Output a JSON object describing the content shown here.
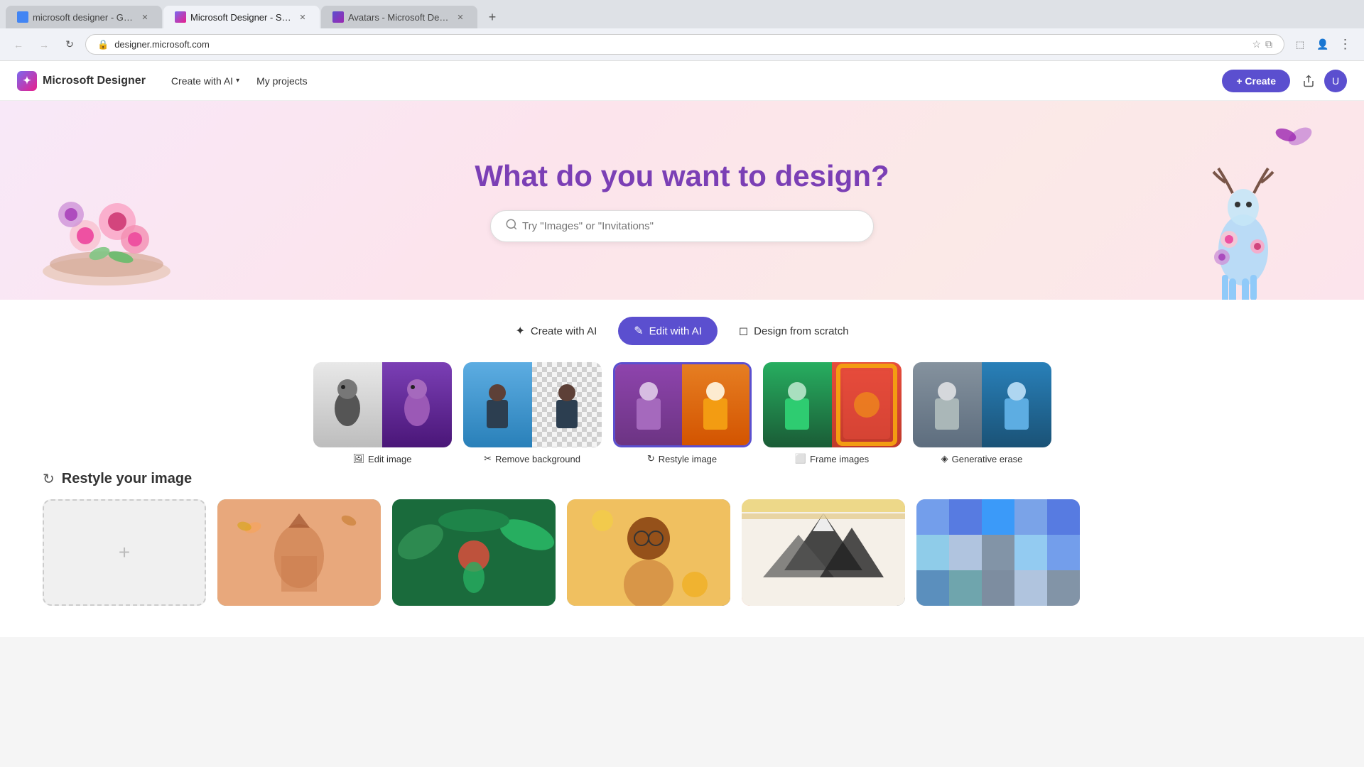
{
  "browser": {
    "tabs": [
      {
        "id": "tab1",
        "title": "microsoft designer - Google S...",
        "favicon_type": "google",
        "active": false,
        "url": ""
      },
      {
        "id": "tab2",
        "title": "Microsoft Designer - Stunning ...",
        "favicon_type": "msdesigner",
        "active": true,
        "url": "designer.microsoft.com"
      },
      {
        "id": "tab3",
        "title": "Avatars - Microsoft Designer",
        "favicon_type": "avatars",
        "active": false,
        "url": ""
      }
    ],
    "address": "designer.microsoft.com",
    "new_tab_label": "+"
  },
  "header": {
    "brand_name": "Microsoft Designer",
    "nav_items": [
      {
        "label": "Create with AI",
        "has_dropdown": true
      },
      {
        "label": "My projects",
        "has_dropdown": false
      }
    ],
    "create_button": "+ Create"
  },
  "hero": {
    "title": "What do you want to design?",
    "search_placeholder": "Try \"Images\" or \"Invitations\""
  },
  "tabs": [
    {
      "label": "Create with AI",
      "icon": "✦",
      "active": false
    },
    {
      "label": "Edit with AI",
      "icon": "✎",
      "active": true
    },
    {
      "label": "Design from scratch",
      "icon": "◻",
      "active": false
    }
  ],
  "feature_cards": [
    {
      "label": "Edit image",
      "icon": "🖼"
    },
    {
      "label": "Remove background",
      "icon": "✂"
    },
    {
      "label": "Restyle image",
      "icon": "↻"
    },
    {
      "label": "Frame images",
      "icon": "⬜"
    },
    {
      "label": "Generative erase",
      "icon": "◈"
    }
  ],
  "restyle_section": {
    "title": "Restyle your image",
    "icon": "↻"
  }
}
